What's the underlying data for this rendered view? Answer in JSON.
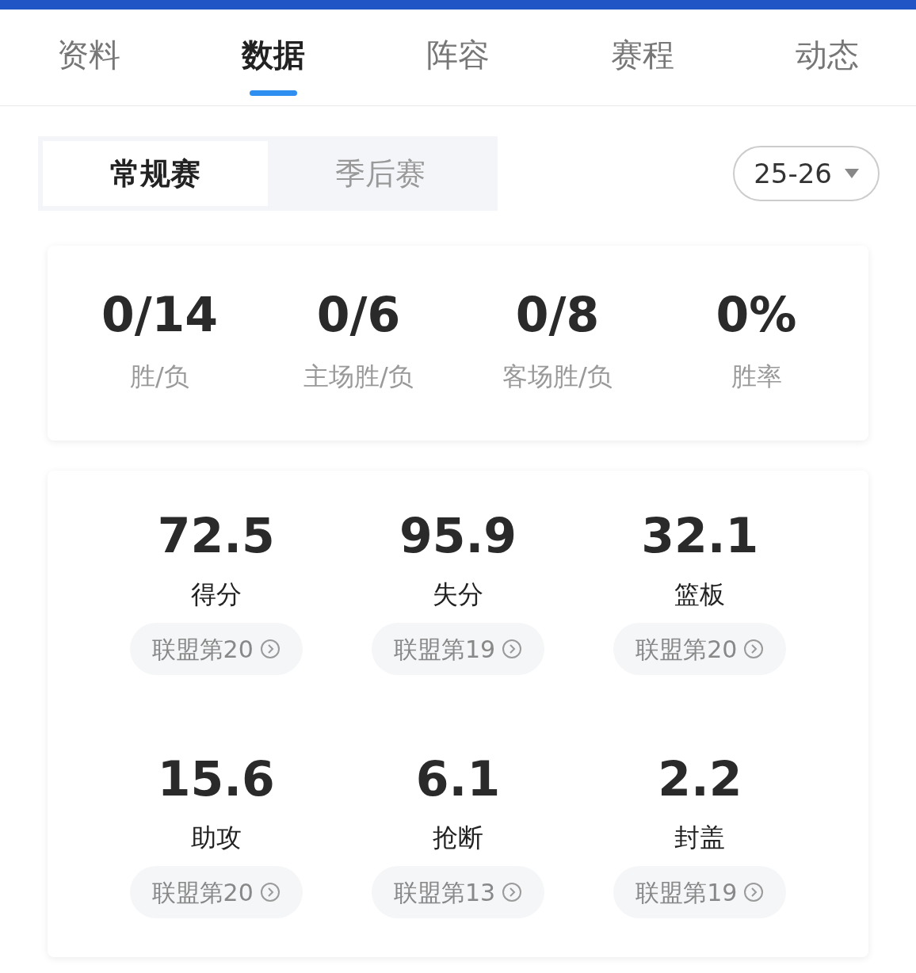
{
  "tabs": [
    {
      "label": "资料",
      "selected": false
    },
    {
      "label": "数据",
      "selected": true
    },
    {
      "label": "阵容",
      "selected": false
    },
    {
      "label": "赛程",
      "selected": false
    },
    {
      "label": "动态",
      "selected": false
    }
  ],
  "season_types": [
    {
      "label": "常规赛",
      "selected": true
    },
    {
      "label": "季后赛",
      "selected": false
    }
  ],
  "season_select": {
    "value": "25-26"
  },
  "record": [
    {
      "value": "0/14",
      "label": "胜/负"
    },
    {
      "value": "0/6",
      "label": "主场胜/负"
    },
    {
      "value": "0/8",
      "label": "客场胜/负"
    },
    {
      "value": "0%",
      "label": "胜率"
    }
  ],
  "stats": [
    {
      "value": "72.5",
      "label": "得分",
      "rank": "联盟第20"
    },
    {
      "value": "95.9",
      "label": "失分",
      "rank": "联盟第19"
    },
    {
      "value": "32.1",
      "label": "篮板",
      "rank": "联盟第20"
    },
    {
      "value": "15.6",
      "label": "助攻",
      "rank": "联盟第20"
    },
    {
      "value": "6.1",
      "label": "抢断",
      "rank": "联盟第13"
    },
    {
      "value": "2.2",
      "label": "封盖",
      "rank": "联盟第19"
    }
  ]
}
